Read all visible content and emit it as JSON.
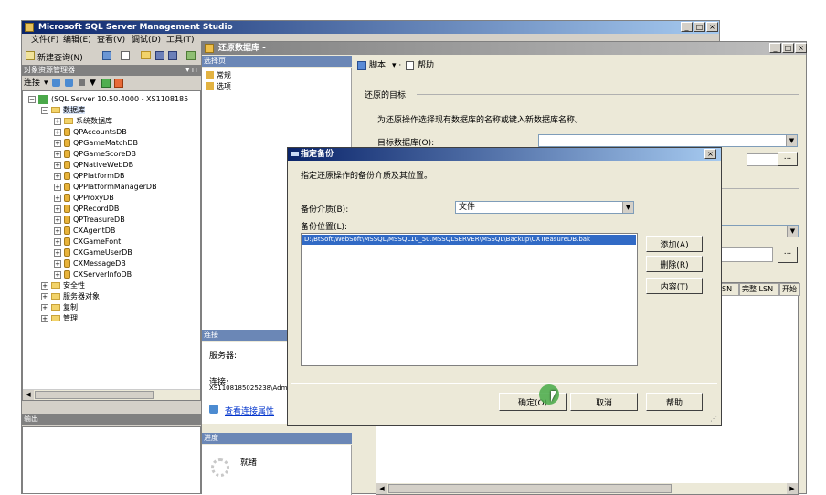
{
  "ssms": {
    "title": "Microsoft SQL Server Management Studio",
    "menu": [
      "文件(F)",
      "编辑(E)",
      "查看(V)",
      "调试(D)",
      "工具(T)",
      "窗口(W)",
      "社区(C)",
      "帮助(H)"
    ],
    "toolbar_new_query": "新建查询(N)",
    "object_explorer_title": "对象资源管理器",
    "connect_label": "连接",
    "server_node": "(SQL Server 10.50.4000 - XS1108185",
    "databases_node": "数据库",
    "system_db": "系统数据库",
    "databases": [
      "QPAccountsDB",
      "QPGameMatchDB",
      "QPGameScoreDB",
      "QPNativeWebDB",
      "QPPlatformDB",
      "QPPlatformManagerDB",
      "QPProxyDB",
      "QPRecordDB",
      "QPTreasureDB",
      "CXAgentDB",
      "CXGameFont",
      "CXGameUserDB",
      "CXMessageDB",
      "CXServerInfoDB"
    ],
    "other_nodes": [
      "安全性",
      "服务器对象",
      "复制",
      "管理"
    ],
    "output_title": "输出"
  },
  "restore": {
    "title": "还原数据库 -",
    "select_page": "选择页",
    "pages": [
      "常规",
      "选项"
    ],
    "toolbar_script": "脚本",
    "toolbar_help": "帮助",
    "section_target": "还原的目标",
    "target_desc": "为还原操作选择现有数据库的名称或键入新数据库名称。",
    "target_db_label": "目标数据库(O):",
    "connection_title": "连接",
    "server_label": "服务器:",
    "connect_label": "连接:",
    "connect_value": "XS1108185025238\\Adm",
    "view_conn_props": "查看连接属性",
    "progress_title": "进度",
    "progress_status": "就绪",
    "grid_headers": [
      "SN",
      "完整 LSN",
      "开始"
    ]
  },
  "dialog": {
    "title": "指定备份",
    "desc": "指定还原操作的备份介质及其位置。",
    "media_label": "备份介质(B):",
    "media_value": "文件",
    "location_label": "备份位置(L):",
    "location_items": [
      "D:\\BtSoft\\WebSoft\\MSSQL\\MSSQL10_50.MSSQLSERVER\\MSSQL\\Backup\\CXTreasureDB.bak"
    ],
    "add_button": "添加(A)",
    "remove_button": "删除(R)",
    "contents_button": "内容(T)",
    "ok_button": "确定(O)",
    "cancel_button": "取消",
    "help_button": "帮助"
  }
}
